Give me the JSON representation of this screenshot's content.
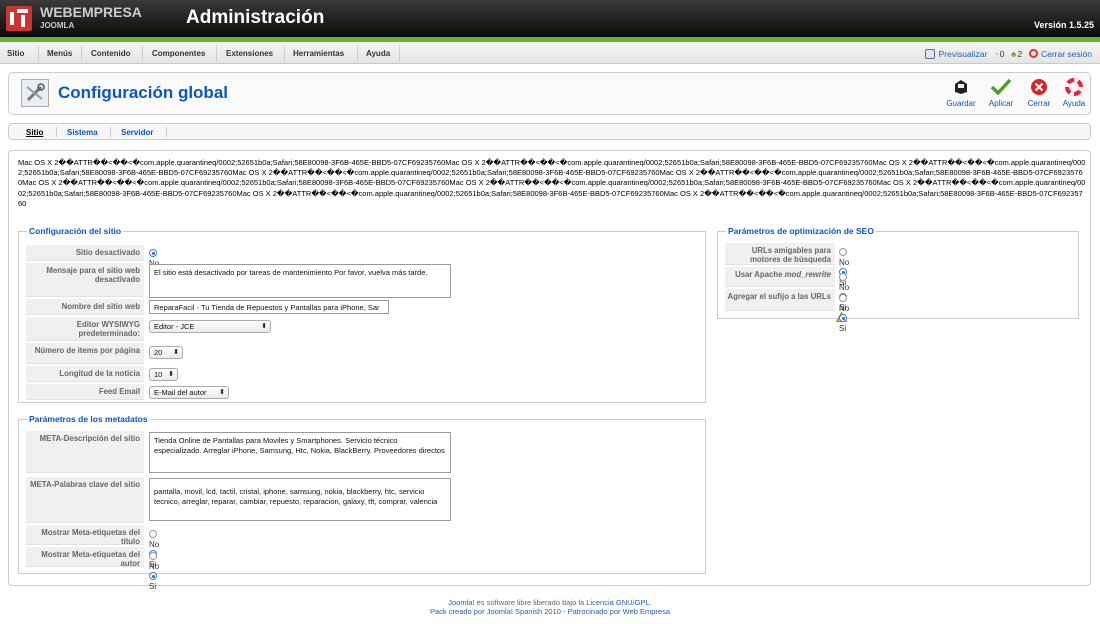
{
  "header": {
    "brand": "WEBEMPRESA",
    "brand_sub": "JOOMLA",
    "title": "Administración",
    "version": "Versión 1.5.25"
  },
  "menu": {
    "items": [
      "Sitio",
      "Menús",
      "Contenido",
      "Componentes",
      "Extensiones",
      "Herramientas",
      "Ayuda"
    ]
  },
  "status": {
    "preview": "Previsualizar",
    "messages": "0",
    "users": "2",
    "logout": "Cerrar sesión"
  },
  "toolbar": {
    "title": "Configuración global",
    "save": "Guardar",
    "apply": "Aplicar",
    "close": "Cerrar",
    "help": "Ayuda"
  },
  "tabs": [
    "Sitio",
    "Sistema",
    "Servidor"
  ],
  "garbage": "Mac OS X  2��ATTR��<��<�com.apple.quarantineq/0002;52651b0a;Safari;58E80098-3F6B-465E-BBD5-07CF69235760Mac OS X  2��ATTR��<��<�com.apple.quarantineq/0002;52651b0a;Safari;58E80098-3F6B-465E-BBD5-07CF69235760Mac OS X  2��ATTR��<��<�com.apple.quarantineq/0002;52651b0a;Safari;58E80098-3F6B-465E-BBD5-07CF69235760Mac OS X  2��ATTR��<��<�com.apple.quarantineq/0002;52651b0a;Safari;58E80098-3F6B-465E-BBD5-07CF69235760Mac OS X  2��ATTR��<��<�com.apple.quarantineq/0002;52651b0a;Safari;58E80098-3F6B-465E-BBD5-07CF69235760Mac OS X  2��ATTR��<��<�com.apple.quarantineq/0002;52651b0a;Safari;58E80098-3F6B-465E-BBD5-07CF69235760Mac OS X  2��ATTR��<��<�com.apple.quarantineq/0002;52651b0a;Safari;58E80098-3F6B-465E-BBD5-07CF69235760Mac OS X  2��ATTR��<��<�com.apple.quarantineq/0002;52651b0a;Safari;58E80098-3F6B-465E-BBD5-07CF69235760Mac OS X  2��ATTR��<��<�com.apple.quarantineq/0002;52651b0a;Safari;58E80098-3F6B-465E-BBD5-07CF69235760Mac OS X  2��ATTR��<��<�com.apple.quarantineq/0002;52651b0a;Safari;58E80098-3F6B-465E-BBD5-07CF69235760",
  "radio": {
    "no": "No",
    "si": "Si"
  },
  "site": {
    "legend": "Configuración del sitio",
    "offline_label": "Sitio desactivado",
    "offline_msg_label": "Mensaje para el sitio web desactivado",
    "offline_msg": "El sitio está desactivado por tareas de mantenimiento  Por favor, vuelva más tarde.",
    "sitename_label": "Nombre del sitio web",
    "sitename": "ReparaFacil - Tu Tienda de Repuestos y Pantallas para iPhone, Sar",
    "editor_label": "Editor WYSIWYG predeterminado:",
    "editor": "Editor - JCE",
    "list_label": "Número de items por página",
    "list": "20",
    "feed_len_label": "Longitud de la noticia",
    "feed_len": "10",
    "feed_email_label": "Feed Email",
    "feed_email": "E-Mail del autor"
  },
  "meta": {
    "legend": "Parámetros de los metadatos",
    "desc_label": "META-Descripción del sitio",
    "desc": "Tienda Online de Pantallas para Moviles y Smartphones.  Servicio técnico especializado. Arreglar iPhone, Samsung, Htc, Nokia, BlackBerry. Proveedores directos",
    "keys_label": "META-Palabras clave del sitio",
    "keys": "pantalla, movil, lcd, tactil, cristal, iphone, samsung, nokia, blackberry, htc, servicio tecnico, arreglar, reparar, cambiar, repuesto, reparacion, galaxy, tft, comprar, valencia",
    "show_title_label": "Mostrar Meta-etiquetas del título",
    "show_author_label": "Mostrar Meta-etiquetas del autor"
  },
  "seo": {
    "legend": "Parámetros de optimización de SEO",
    "sef_label": "URLs amigables para motores de búsqueda",
    "rewrite_label_pre": "Usar Apache ",
    "rewrite_label_em": "mod_rewrite",
    "suffix_label": "Agregar el sufijo a las URLs"
  },
  "footer": {
    "line1_pre": "Joomla!",
    "line1_mid": " es software libre liberado bajo la ",
    "line1_link": "Licencia GNU/GPL",
    "line1_end": ".",
    "line2": "Pack creado por Joomla! Spanish 2010 - Patrocinado por Web Empresa"
  }
}
